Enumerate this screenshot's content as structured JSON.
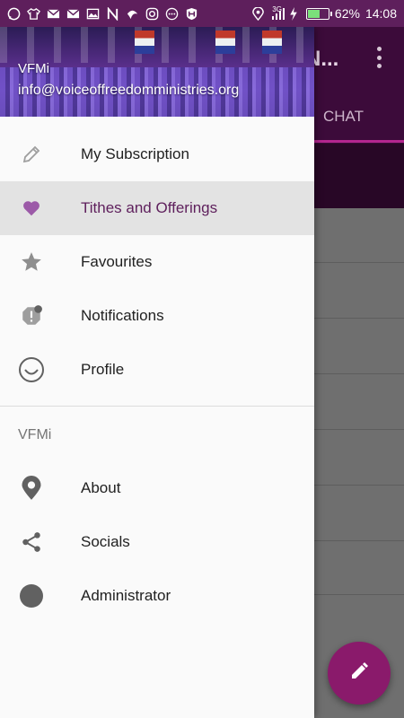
{
  "status_bar": {
    "battery": "62%",
    "battery_level": 0.62,
    "time": "14:08",
    "network": "3G",
    "left_icons": [
      "whatsapp-icon",
      "shirt-icon",
      "gmail-icon",
      "gmail-icon",
      "image-icon",
      "app-n-icon",
      "app-icon",
      "instagram-icon",
      "more-icon",
      "app-shield-icon"
    ]
  },
  "app": {
    "title_partial": "N...",
    "tab_label": "CHAT"
  },
  "drawer": {
    "header": {
      "name": "VFMi",
      "email": "info@voiceoffreedomministries.org"
    },
    "items": [
      {
        "label": "My Subscription",
        "icon": "pencil-icon"
      },
      {
        "label": "Tithes and Offerings",
        "icon": "heart-icon",
        "selected": true
      },
      {
        "label": "Favourites",
        "icon": "star-icon"
      },
      {
        "label": "Notifications",
        "icon": "notification-icon"
      },
      {
        "label": "Profile",
        "icon": "smile-icon"
      }
    ],
    "section_title": "VFMi",
    "section_items": [
      {
        "label": "About",
        "icon": "location-pin-icon"
      },
      {
        "label": "Socials",
        "icon": "share-icon"
      },
      {
        "label": "Administrator",
        "icon": "circle-icon"
      }
    ]
  },
  "colors": {
    "primary": "#5e1f5c",
    "accent": "#8a1a6b",
    "selected_bg": "#e3e3e3"
  }
}
